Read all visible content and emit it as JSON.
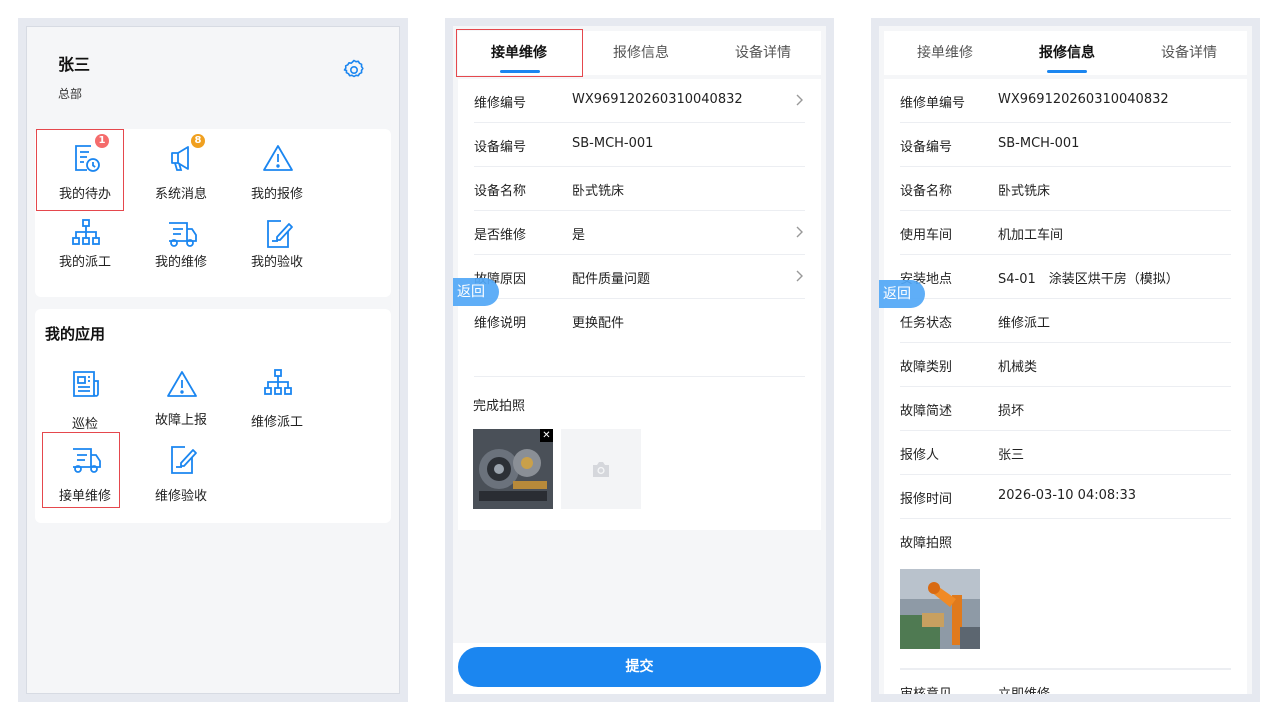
{
  "panel1": {
    "user_name": "张三",
    "user_dept": "总部",
    "quick": [
      {
        "label": "我的待办",
        "icon": "todo-clock-icon",
        "badge": "1",
        "badge_color": "#f56c6c"
      },
      {
        "label": "系统消息",
        "icon": "megaphone-icon",
        "badge": "8",
        "badge_color": "#f0a020"
      },
      {
        "label": "我的报修",
        "icon": "warning-icon"
      },
      {
        "label": "我的派工",
        "icon": "org-tree-icon"
      },
      {
        "label": "我的维修",
        "icon": "truck-icon"
      },
      {
        "label": "我的验收",
        "icon": "edit-doc-icon"
      }
    ],
    "apps_title": "我的应用",
    "apps": [
      {
        "label": "巡检",
        "icon": "news-icon"
      },
      {
        "label": "故障上报",
        "icon": "warning-icon"
      },
      {
        "label": "维修派工",
        "icon": "org-tree-icon"
      },
      {
        "label": "接单维修",
        "icon": "truck-icon"
      },
      {
        "label": "维修验收",
        "icon": "edit-doc-icon"
      }
    ]
  },
  "panel2": {
    "tabs": [
      "接单维修",
      "报修信息",
      "设备详情"
    ],
    "active_tab": 0,
    "rows": [
      {
        "label": "维修编号",
        "value": "WX969120260310040832",
        "chevron": true
      },
      {
        "label": "设备编号",
        "value": "SB-MCH-001",
        "chevron": false
      },
      {
        "label": "设备名称",
        "value": "卧式铣床",
        "chevron": false
      },
      {
        "label": "是否维修",
        "value": "是",
        "chevron": true
      },
      {
        "label": "故障原因",
        "value": "配件质量问题",
        "chevron": true
      },
      {
        "label": "维修说明",
        "value": "更换配件",
        "chevron": false
      }
    ],
    "photo_label": "完成拍照",
    "back_label": "返回",
    "submit_label": "提交"
  },
  "panel3": {
    "tabs": [
      "接单维修",
      "报修信息",
      "设备详情"
    ],
    "active_tab": 1,
    "rows": [
      {
        "label": "维修单编号",
        "value": "WX969120260310040832"
      },
      {
        "label": "设备编号",
        "value": "SB-MCH-001"
      },
      {
        "label": "设备名称",
        "value": "卧式铣床"
      },
      {
        "label": "使用车间",
        "value": "机加工车间"
      },
      {
        "label": "安装地点",
        "value": "S4-01　涂装区烘干房（模拟）"
      },
      {
        "label": "任务状态",
        "value": "维修派工"
      },
      {
        "label": "故障类别",
        "value": "机械类"
      },
      {
        "label": "故障简述",
        "value": "损坏"
      },
      {
        "label": "报修人",
        "value": "张三"
      },
      {
        "label": "报修时间",
        "value": "2026-03-10 04:08:33"
      }
    ],
    "photo_label": "故障拍照",
    "cut_row": {
      "label": "审核意见",
      "value": "立即维修"
    },
    "back_label": "返回"
  },
  "colors": {
    "accent": "#1b86f0",
    "highlight": "#e5484d",
    "icon": "#1b86f0"
  }
}
